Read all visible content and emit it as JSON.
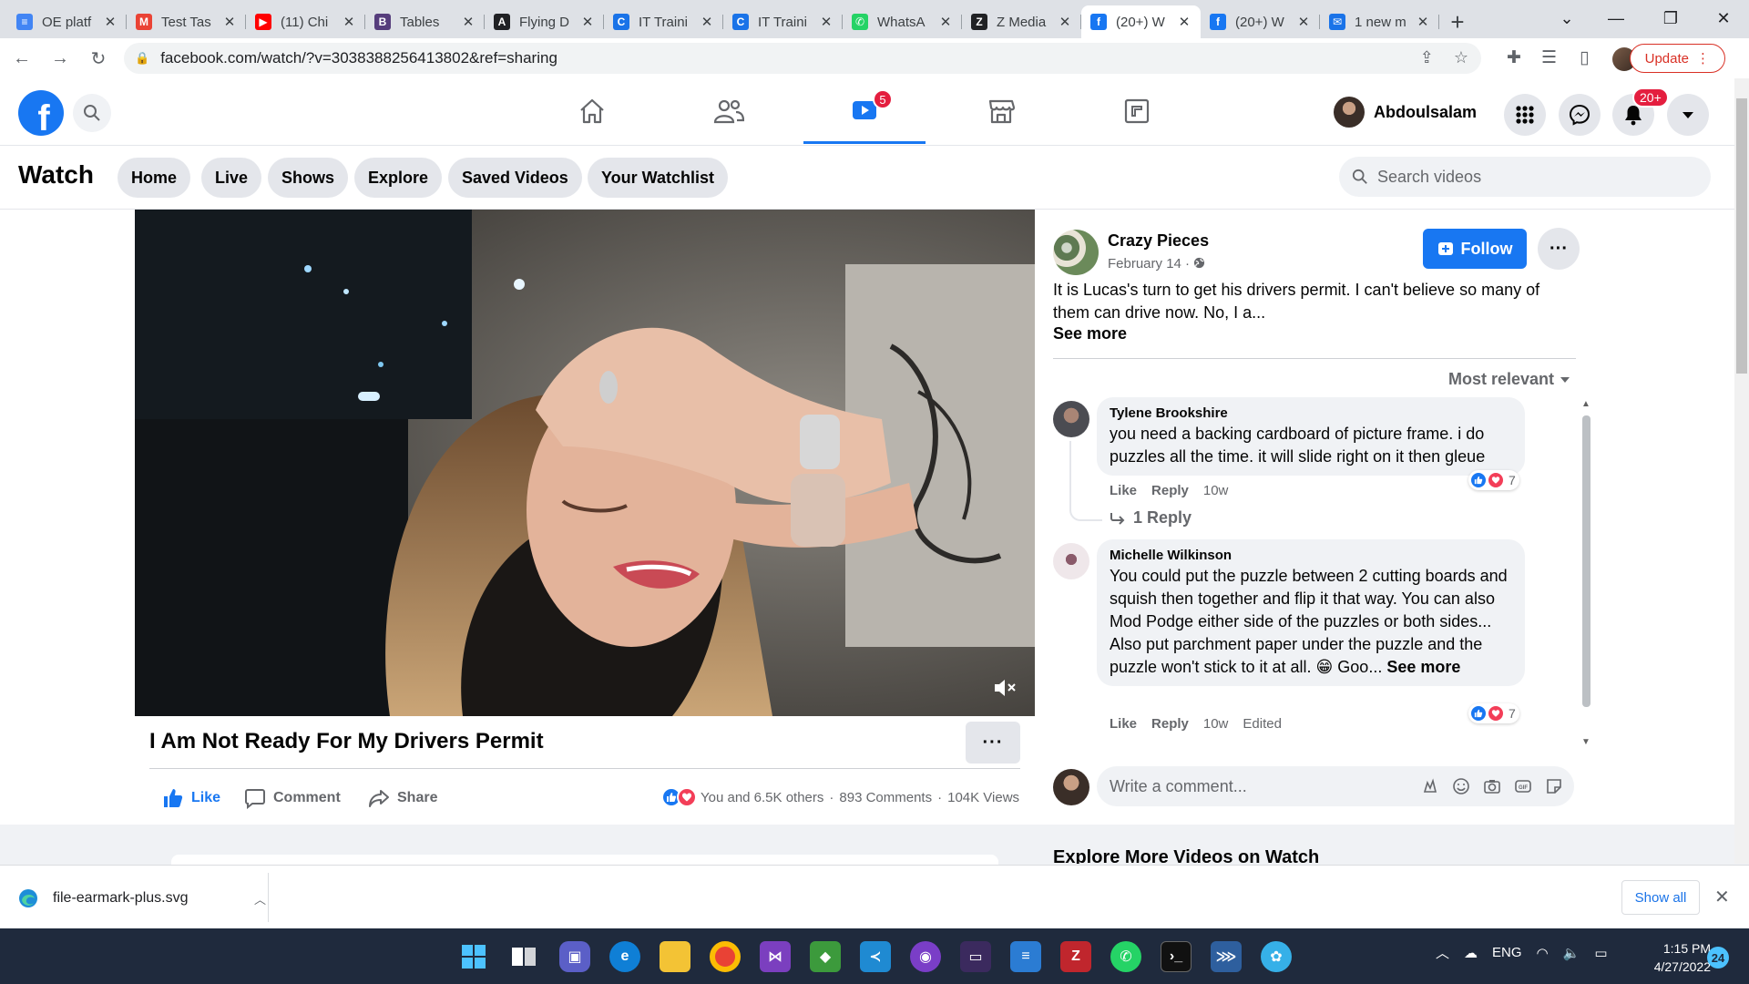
{
  "browser": {
    "tabs": [
      {
        "title": "OE platf",
        "icon": "google-docs-icon",
        "color": "#4285f4"
      },
      {
        "title": "Test Tas",
        "icon": "gmail-icon",
        "color": "#ea4335"
      },
      {
        "title": "(11) Chi",
        "icon": "youtube-icon",
        "color": "#ff0000"
      },
      {
        "title": "Tables",
        "icon": "bootstrap-icon",
        "color": "#563d7c"
      },
      {
        "title": "Flying D",
        "icon": "angular-icon",
        "color": "#202124"
      },
      {
        "title": "IT Traini",
        "icon": "site-icon",
        "color": "#1a73e8"
      },
      {
        "title": "IT Traini",
        "icon": "site-icon",
        "color": "#1a73e8"
      },
      {
        "title": "WhatsA",
        "icon": "whatsapp-icon",
        "color": "#25d366"
      },
      {
        "title": "Z Media",
        "icon": "zmedia-icon",
        "color": "#202124"
      },
      {
        "title": "(20+) W",
        "icon": "facebook-icon",
        "color": "#1877f2"
      },
      {
        "title": "(20+) W",
        "icon": "facebook-icon",
        "color": "#1877f2"
      },
      {
        "title": "1 new m",
        "icon": "mail-icon",
        "color": "#1a73e8"
      }
    ],
    "active_tab": 9,
    "url": "facebook.com/watch/?v=3038388256413802&ref=sharing",
    "update_label": "Update"
  },
  "facebook": {
    "logo_letter": "f",
    "nav_badge_watch": "5",
    "user_name": "Abdoulsalam",
    "notifications_badge": "20+",
    "watch_title": "Watch",
    "watch_tabs": [
      "Home",
      "Live",
      "Shows",
      "Explore",
      "Saved Videos",
      "Your Watchlist"
    ],
    "search_placeholder": "Search videos"
  },
  "video": {
    "title": "I Am Not Ready For My Drivers Permit",
    "actions": {
      "like": "Like",
      "comment": "Comment",
      "share": "Share"
    },
    "reactions_text": "You and 6.5K others",
    "comments_count": "893 Comments",
    "views": "104K Views",
    "separator": "·"
  },
  "post": {
    "page_name": "Crazy Pieces",
    "date": "February 14 ·",
    "follow_label": "Follow",
    "text": "It is Lucas's turn to get his drivers permit. I can't believe so many of them can drive now. No, I a...",
    "see_more": "See more",
    "sort_label": "Most relevant"
  },
  "comments": [
    {
      "author": "Tylene Brookshire",
      "text": "you need a backing cardboard of picture frame. i do puzzles all the time. it will slide right on it then gleue",
      "like": "Like",
      "reply": "Reply",
      "time": "10w",
      "reaction_count": "7",
      "replies_label": "1 Reply"
    },
    {
      "author": "Michelle Wilkinson",
      "text_1": "You could put the puzzle between 2 cutting boards and squish then together and flip it that way. You can also Mod Podge either side of the puzzles or both sides...",
      "text_2": "Also put parchment paper under the puzzle and the puzzle won't stick to it at all. 😁 Goo...",
      "see_more": "See more",
      "like": "Like",
      "reply": "Reply",
      "time": "10w",
      "edited": "Edited",
      "reaction_count": "7"
    }
  ],
  "composer": {
    "placeholder": "Write a comment..."
  },
  "explore_heading": "Explore More Videos on Watch",
  "download": {
    "file": "file-earmark-plus.svg",
    "show_all": "Show all"
  },
  "taskbar": {
    "lang": "ENG",
    "time": "1:15 PM",
    "date": "4/27/2022",
    "notif_count": "24"
  },
  "colors": {
    "facebook_blue": "#1877f2",
    "badge_red": "#e41e3f"
  }
}
